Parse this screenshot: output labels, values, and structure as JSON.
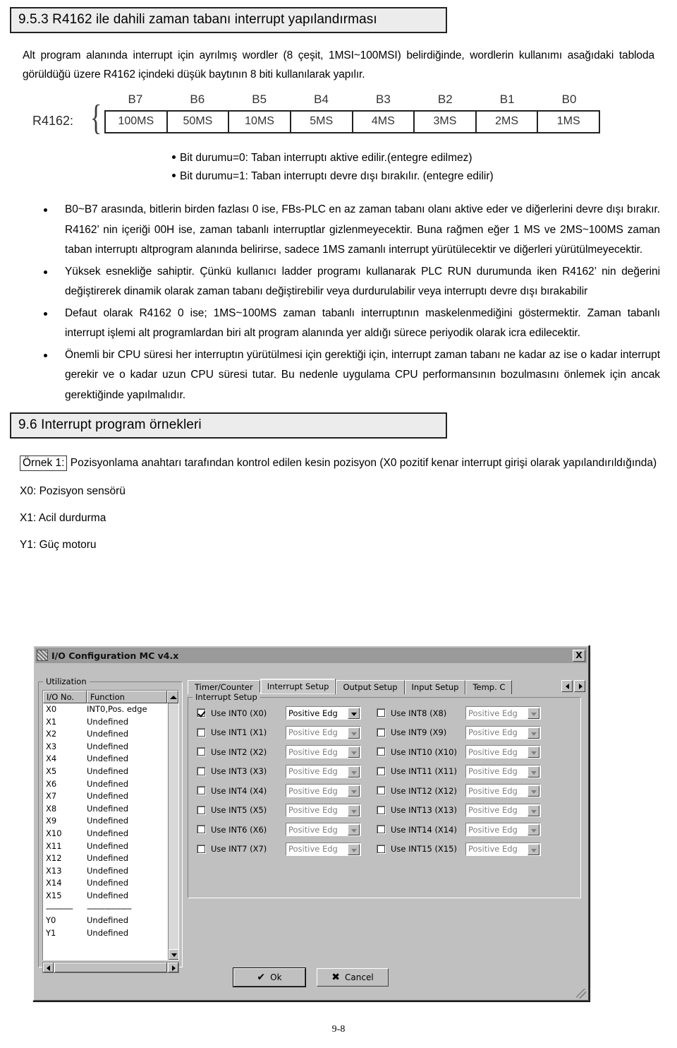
{
  "headings": {
    "section_953": "9.5.3 R4162 ile dahili zaman tabanı interrupt yapılandırması",
    "section_96": "9.6 Interrupt program örnekleri"
  },
  "intro_paragraph": "Alt program alanında interrupt için ayrılmış wordler (8 çeşit, 1MSI~100MSI) belirdiğinde, wordlerin kullanımı asağıdaki tabloda görüldüğü üzere R4162 içindeki düşük baytının 8 biti kullanılarak yapılır.",
  "bit_figure": {
    "register_label": "R4162:",
    "bit_labels": [
      "B7",
      "B6",
      "B5",
      "B4",
      "B3",
      "B2",
      "B1",
      "B0"
    ],
    "bit_values": [
      "100MS",
      "50MS",
      "10MS",
      "5MS",
      "4MS",
      "3MS",
      "2MS",
      "1MS"
    ]
  },
  "bit_state_notes": [
    "Bit durumu=0: Taban interruptı aktive edilir.(entegre edilmez)",
    "Bit durumu=1: Taban interruptı devre dışı bırakılır. (entegre edilir)"
  ],
  "bullets": [
    "B0~B7 arasında, bitlerin birden fazlası 0 ise, FBs-PLC en az zaman tabanı olanı aktive eder ve diğerlerini devre dışı bırakır. R4162’ nin içeriği 00H ise, zaman tabanlı interruptlar gizlenmeyecektir. Buna rağmen eğer 1 MS ve 2MS~100MS zaman taban interruptı altprogram alanında belirirse, sadece 1MS zamanlı interrupt yürütülecektir ve diğerleri yürütülmeyecektir.",
    "Yüksek esnekliğe sahiptir. Çünkü kullanıcı ladder programı kullanarak PLC RUN durumunda iken R4162’ nin değerini değiştirerek dinamik olarak zaman tabanı değiştirebilir veya durdurulabilir veya interruptı devre dışı bırakabilir",
    "Defaut olarak R4162 0 ise; 1MS~100MS zaman tabanlı interruptının maskelenmediğini göstermektir. Zaman tabanlı interrupt işlemi alt programlardan biri alt program alanında yer aldığı sürece periyodik olarak icra edilecektir.",
    "Önemli bir CPU süresi her interruptın yürütülmesi için gerektiği için, interrupt zaman tabanı ne kadar az ise o kadar interrupt gerekir ve o kadar uzun CPU süresi tutar. Bu nedenle uygulama CPU performansının bozulmasını önlemek için ancak gerektiğinde yapılmalıdır."
  ],
  "example": {
    "tag": "Örnek 1:",
    "title": "Pozisyonlama anahtarı tarafından kontrol edilen kesin pozisyon (X0 pozitif kenar interrupt girişi olarak yapılandırıldığında)",
    "io_lines": [
      "X0: Pozisyon sensörü",
      "X1: Acil durdurma",
      "Y1: Güç motoru"
    ]
  },
  "dialog": {
    "title": "I/O Configuration MC v4.x",
    "close_label": "X",
    "utilization": {
      "group_title": "Utilization",
      "columns": [
        "I/O No.",
        "Function"
      ],
      "rows": [
        {
          "io": "X0",
          "fn": "INT0,Pos. edge"
        },
        {
          "io": "X1",
          "fn": "Undefined"
        },
        {
          "io": "X2",
          "fn": "Undefined"
        },
        {
          "io": "X3",
          "fn": "Undefined"
        },
        {
          "io": "X4",
          "fn": "Undefined"
        },
        {
          "io": "X5",
          "fn": "Undefined"
        },
        {
          "io": "X6",
          "fn": "Undefined"
        },
        {
          "io": "X7",
          "fn": "Undefined"
        },
        {
          "io": "X8",
          "fn": "Undefined"
        },
        {
          "io": "X9",
          "fn": "Undefined"
        },
        {
          "io": "X10",
          "fn": "Undefined"
        },
        {
          "io": "X11",
          "fn": "Undefined"
        },
        {
          "io": "X12",
          "fn": "Undefined"
        },
        {
          "io": "X13",
          "fn": "Undefined"
        },
        {
          "io": "X14",
          "fn": "Undefined"
        },
        {
          "io": "X15",
          "fn": "Undefined"
        },
        {
          "io": "------------",
          "fn": "--------------------",
          "separator": true
        },
        {
          "io": "Y0",
          "fn": "Undefined"
        },
        {
          "io": "Y1",
          "fn": "Undefined"
        }
      ]
    },
    "tabs": [
      {
        "label": "Timer/Counter",
        "active": false
      },
      {
        "label": "Interrupt Setup",
        "active": true
      },
      {
        "label": "Output Setup",
        "active": false
      },
      {
        "label": "Input Setup",
        "active": false
      },
      {
        "label": "Temp. C",
        "active": false
      }
    ],
    "interrupt_setup": {
      "group_title": "Interrupt Setup",
      "left_column": [
        {
          "label": "Use INT0 (X0)",
          "checked": true,
          "edge": "Positive Edg",
          "enabled": true
        },
        {
          "label": "Use INT1 (X1)",
          "checked": false,
          "edge": "Positive Edg",
          "enabled": false
        },
        {
          "label": "Use INT2 (X2)",
          "checked": false,
          "edge": "Positive Edg",
          "enabled": false
        },
        {
          "label": "Use INT3 (X3)",
          "checked": false,
          "edge": "Positive Edg",
          "enabled": false
        },
        {
          "label": "Use INT4 (X4)",
          "checked": false,
          "edge": "Positive Edg",
          "enabled": false
        },
        {
          "label": "Use INT5 (X5)",
          "checked": false,
          "edge": "Positive Edg",
          "enabled": false
        },
        {
          "label": "Use INT6 (X6)",
          "checked": false,
          "edge": "Positive Edg",
          "enabled": false
        },
        {
          "label": "Use INT7 (X7)",
          "checked": false,
          "edge": "Positive Edg",
          "enabled": false
        }
      ],
      "right_column": [
        {
          "label": "Use INT8 (X8)",
          "checked": false,
          "edge": "Positive Edg",
          "enabled": false
        },
        {
          "label": "Use INT9 (X9)",
          "checked": false,
          "edge": "Positive Edg",
          "enabled": false
        },
        {
          "label": "Use INT10 (X10)",
          "checked": false,
          "edge": "Positive Edg",
          "enabled": false
        },
        {
          "label": "Use INT11 (X11)",
          "checked": false,
          "edge": "Positive Edg",
          "enabled": false
        },
        {
          "label": "Use INT12 (X12)",
          "checked": false,
          "edge": "Positive Edg",
          "enabled": false
        },
        {
          "label": "Use INT13 (X13)",
          "checked": false,
          "edge": "Positive Edg",
          "enabled": false
        },
        {
          "label": "Use INT14 (X14)",
          "checked": false,
          "edge": "Positive Edg",
          "enabled": false
        },
        {
          "label": "Use INT15 (X15)",
          "checked": false,
          "edge": "Positive Edg",
          "enabled": false
        }
      ]
    },
    "buttons": {
      "ok": "Ok",
      "cancel": "Cancel",
      "ok_icon": "check-icon",
      "cancel_icon": "cross-icon"
    }
  },
  "page_number": "9-8"
}
